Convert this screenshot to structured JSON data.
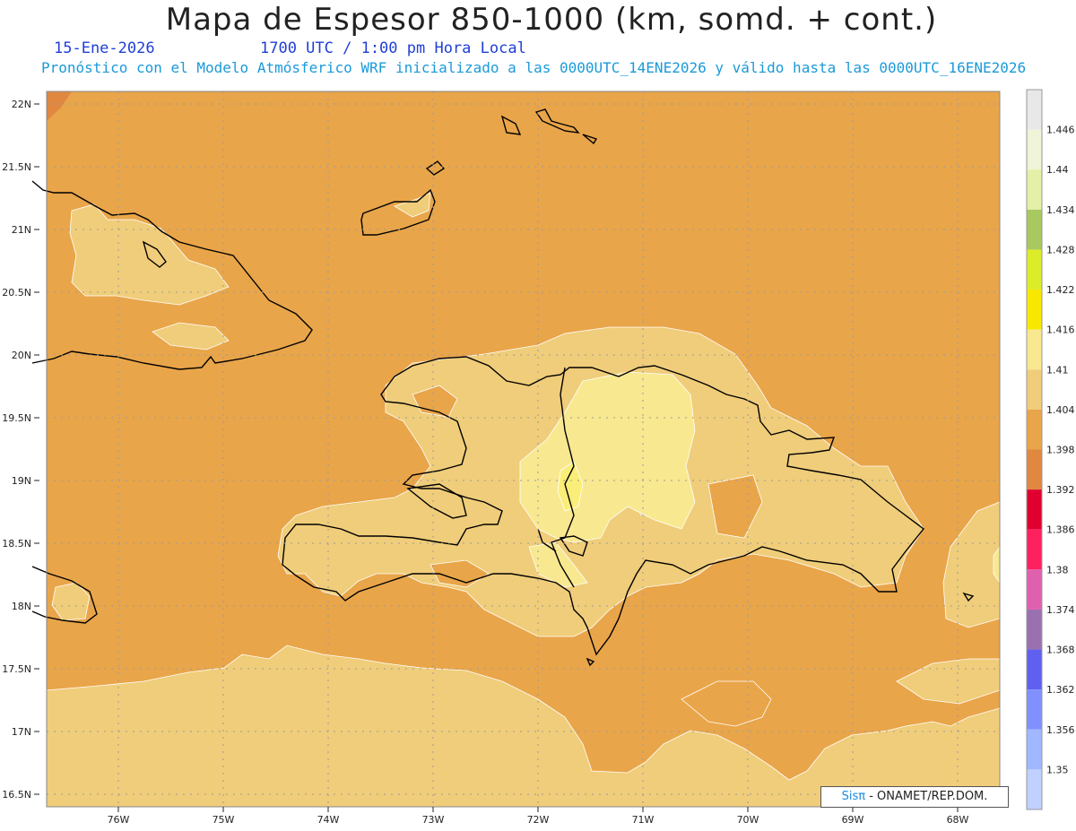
{
  "header": {
    "title": "Mapa de Espesor 850-1000 (km, somd. + cont.)",
    "date": "15-Ene-2026",
    "time": "1700 UTC / 1:00 pm Hora Local",
    "model_line": "Pronóstico con el Modelo Atmósferico WRF inicializado a las 0000UTC_14ENE2026 y válido hasta las  0000UTC_16ENE2026"
  },
  "axes": {
    "lat_ticks": [
      "22N",
      "21.5N",
      "21N",
      "20.5N",
      "20N",
      "19.5N",
      "19N",
      "18.5N",
      "18N",
      "17.5N",
      "17N",
      "16.5N"
    ],
    "lon_ticks": [
      "76W",
      "75W",
      "74W",
      "73W",
      "72W",
      "71W",
      "70W",
      "69W",
      "68W"
    ]
  },
  "colorbar": {
    "labels": [
      "1.446",
      "1.44",
      "1.434",
      "1.428",
      "1.422",
      "1.416",
      "1.41",
      "1.404",
      "1.398",
      "1.392",
      "1.386",
      "1.38",
      "1.374",
      "1.368",
      "1.362",
      "1.356",
      "1.35"
    ],
    "colors": [
      "#e8e8e8",
      "#f0f4d8",
      "#e4f0a8",
      "#a8c860",
      "#dcec28",
      "#f8e800",
      "#f8e890",
      "#f0cd7a",
      "#e9a549",
      "#e08840",
      "#e00030",
      "#ff2060",
      "#e060b0",
      "#9b70b0",
      "#6060f0",
      "#8090ff",
      "#a0b8ff",
      "#c0d0ff"
    ]
  },
  "map_colors": {
    "sea_base": "#e9a549",
    "zone_1404": "#f0cd7a",
    "zone_1410": "#f8e890",
    "zone_1416": "#fbec7e",
    "coast": "#000000",
    "grid": "#9a9a9a"
  },
  "credit": {
    "brand": "Sisπ",
    "org": " - ONAMET/REP.DOM."
  }
}
